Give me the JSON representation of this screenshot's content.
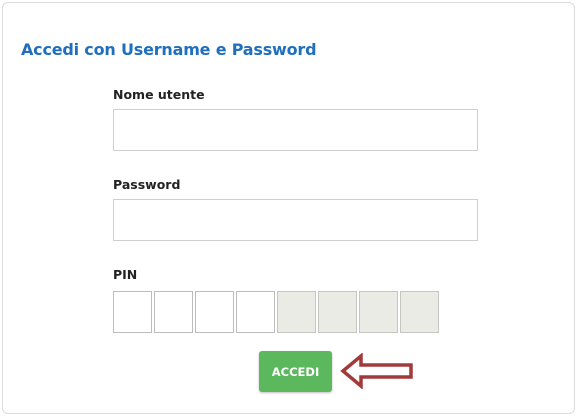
{
  "form": {
    "title": "Accedi con Username e Password",
    "username": {
      "label": "Nome utente",
      "value": "",
      "placeholder": ""
    },
    "password": {
      "label": "Password",
      "value": "",
      "placeholder": ""
    },
    "pin": {
      "label": "PIN",
      "digits_total": 8,
      "enabled_digits": 4
    },
    "submit_label": "ACCEDI"
  },
  "colors": {
    "title": "#1f6fbd",
    "submit_bg": "#5cb85c",
    "arrow": "#a33a3a",
    "pin_disabled_bg": "#ebebe6"
  },
  "icons": {
    "annotation": "left-arrow-icon"
  }
}
